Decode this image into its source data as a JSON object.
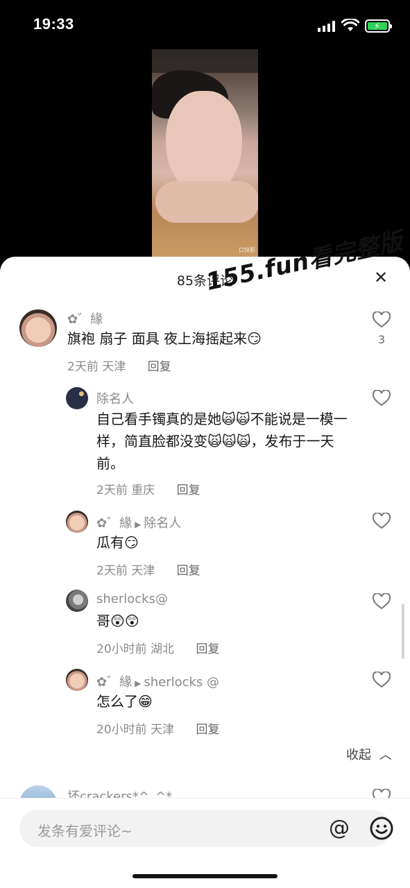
{
  "status_bar": {
    "time": "19:33"
  },
  "video": {
    "corner_tag": "口快影"
  },
  "watermark": "155.fun看完整版",
  "sheet": {
    "title": "85条评论"
  },
  "comments": [
    {
      "user": "✿゛緣",
      "text": "旗袍 扇子 面具 夜上海摇起来😏",
      "time": "2天前",
      "location": "天津",
      "reply": "回复",
      "likes": "3"
    },
    {
      "user": "除名人",
      "text": "自己看手镯真的是她🙀🙀不能说是一模一样，简直脸都没变🙀🙀🙀，发布于一天前。",
      "time": "2天前",
      "location": "重庆",
      "reply": "回复"
    },
    {
      "user": "✿゛緣",
      "reply_to": "除名人",
      "text": "瓜有😏",
      "time": "2天前",
      "location": "天津",
      "reply": "回复"
    },
    {
      "user": "sherlocks@",
      "text": "哥😲😲",
      "time": "20小时前",
      "location": "湖北",
      "reply": "回复"
    },
    {
      "user": "✿゛緣",
      "reply_to": "sherlocks @",
      "text": "怎么了😁",
      "time": "20小时前",
      "location": "天津",
      "reply": "回复"
    },
    {
      "user": "坏crackers*^_^*"
    }
  ],
  "collapse_label": "收起",
  "input": {
    "placeholder": "发条有爱评论~"
  }
}
